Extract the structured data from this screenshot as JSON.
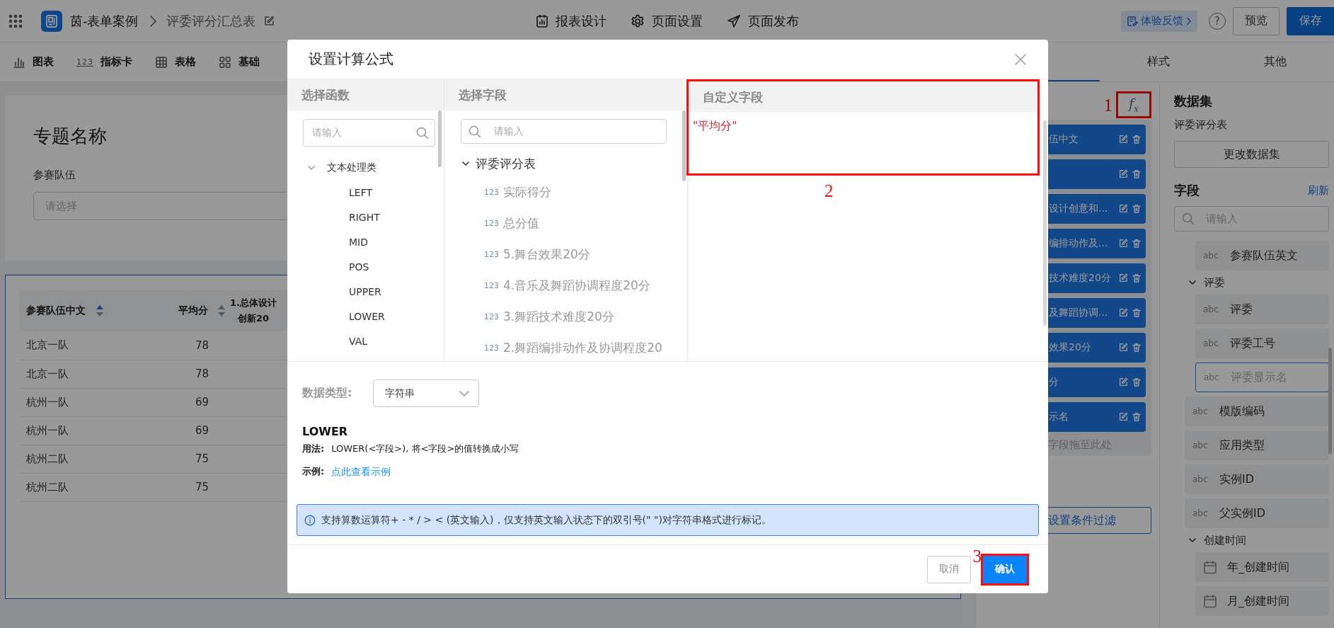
{
  "topbar": {
    "app_name": "茵-表单案例",
    "page_title": "评委评分汇总表",
    "nav": [
      {
        "label": "报表设计"
      },
      {
        "label": "页面设置"
      },
      {
        "label": "页面发布"
      }
    ],
    "feedback": "体验反馈",
    "help": "?",
    "preview": "预览",
    "save": "保存"
  },
  "toolbar": [
    {
      "label": "图表"
    },
    {
      "badge": "123",
      "label": "指标卡"
    },
    {
      "label": "表格"
    },
    {
      "label": "基础"
    }
  ],
  "canvas": {
    "title": "专题名称",
    "filter_label": "参赛队伍",
    "filter_placeholder": "请选择",
    "table": {
      "columns": [
        {
          "lines": [
            "参赛队伍中文"
          ],
          "sorted_ascending": true
        },
        {
          "lines": [
            "平均分"
          ],
          "sorted_ascending": false
        },
        {
          "lines": [
            "1.总体设计",
            "创新20"
          ]
        }
      ],
      "rows": [
        [
          "北京一队",
          "78"
        ],
        [
          "北京一队",
          "78"
        ],
        [
          "杭州一队",
          "69"
        ],
        [
          "杭州一队",
          "69"
        ],
        [
          "杭州二队",
          "75"
        ],
        [
          "杭州二队",
          "75"
        ]
      ]
    }
  },
  "panel": {
    "tabs": [
      {
        "selected": true
      },
      {
        "label": "样式",
        "selected": false
      },
      {
        "label": "其他",
        "selected": false
      }
    ],
    "formula_button": {
      "label": "f$_{x}$",
      "annotation": "1"
    },
    "chips": [
      {
        "kind": "labeled",
        "label": "伍中文"
      },
      {
        "kind": "blank"
      },
      {
        "kind": "labeled",
        "label": "设计创意和..."
      },
      {
        "kind": "labeled",
        "label": "编排动作及..."
      },
      {
        "kind": "labeled",
        "label": "技术难度20分"
      },
      {
        "kind": "labeled",
        "label": "及舞蹈协调..."
      },
      {
        "kind": "labeled",
        "label": "效果20分"
      },
      {
        "kind": "labeled",
        "label": "分"
      },
      {
        "kind": "labeled",
        "label": "示名"
      }
    ],
    "drop_hint": "字段拖至此处",
    "filter_button": "设置条件过滤",
    "dataset": {
      "heading": "数据集",
      "name": "评委评分表",
      "change_button": "更改数据集"
    },
    "fields": {
      "heading": "字段",
      "refresh": "刷新",
      "search_placeholder": "请输入",
      "items": [
        {
          "kind": "group",
          "children": [
            {
              "kind": "field",
              "type_label": "abc",
              "label": "参赛队伍英文",
              "dragging": false
            }
          ]
        },
        {
          "kind": "group",
          "label": "评委",
          "expanded": true,
          "children": [
            {
              "kind": "field",
              "type_label": "abc",
              "label": "评委",
              "dragging": false
            },
            {
              "kind": "field",
              "type_label": "abc",
              "label": "评委工号",
              "dragging": false
            },
            {
              "kind": "field",
              "type_label": "abc",
              "label": "评委显示名",
              "dragging": true
            }
          ]
        },
        {
          "kind": "field",
          "type_label": "abc",
          "label": "模版编码",
          "dragging": false
        },
        {
          "kind": "field",
          "type_label": "abc",
          "label": "应用类型",
          "dragging": false
        },
        {
          "kind": "field",
          "type_label": "abc",
          "label": "实例ID",
          "dragging": false
        },
        {
          "kind": "field",
          "type_label": "abc",
          "label": "父实例ID",
          "dragging": false
        },
        {
          "kind": "group",
          "label": "创建时间",
          "expanded": true,
          "children": [
            {
              "kind": "date_field",
              "label": "年_创建时间",
              "dragging": false
            },
            {
              "kind": "date_field",
              "label": "月_创建时间",
              "dragging": false
            }
          ]
        }
      ]
    }
  },
  "dialog": {
    "title": "设置计算公式",
    "functions": {
      "heading": "选择函数",
      "search_placeholder": "请输入",
      "groups": [
        {
          "label": "文本处理类",
          "expanded": true,
          "children": [
            {
              "label": "LEFT"
            },
            {
              "label": "RIGHT"
            },
            {
              "label": "MID"
            },
            {
              "label": "POS"
            },
            {
              "label": "UPPER"
            },
            {
              "label": "LOWER"
            },
            {
              "label": "VAL"
            }
          ]
        }
      ]
    },
    "fields": {
      "heading": "选择字段",
      "search_placeholder": "请输入",
      "tree": {
        "label": "评委评分表",
        "expanded": true,
        "children": [
          {
            "type_label": "123",
            "label": "实际得分"
          },
          {
            "type_label": "123",
            "label": "总分值"
          },
          {
            "type_label": "123",
            "label": "5.舞台效果20分"
          },
          {
            "type_label": "123",
            "label": "4.音乐及舞蹈协调程度20分"
          },
          {
            "type_label": "123",
            "label": "3.舞蹈技术难度20分"
          },
          {
            "type_label": "123",
            "label": "2.舞蹈编排动作及协调程度20"
          }
        ]
      }
    },
    "custom": {
      "heading": "自定义字段",
      "value": "\"平均分\"",
      "annotation": "2"
    },
    "data_type": {
      "label": "数据类型:",
      "value": "字符串"
    },
    "help": {
      "name": "LOWER",
      "usage_label": "用法:",
      "usage": "LOWER(<字段>), 将<字段>的值转换成小写",
      "example_label": "示例:",
      "example_link": "点此查看示例"
    },
    "notice": "支持算数运算符+ - * / > < (英文输入)，仅支持英文输入状态下的双引号(\" \")对字符串格式进行标记。",
    "buttons": [
      {
        "kind": "cancel",
        "label": "取消"
      },
      {
        "kind": "confirm",
        "label": "确认",
        "annotation": "3"
      }
    ]
  }
}
